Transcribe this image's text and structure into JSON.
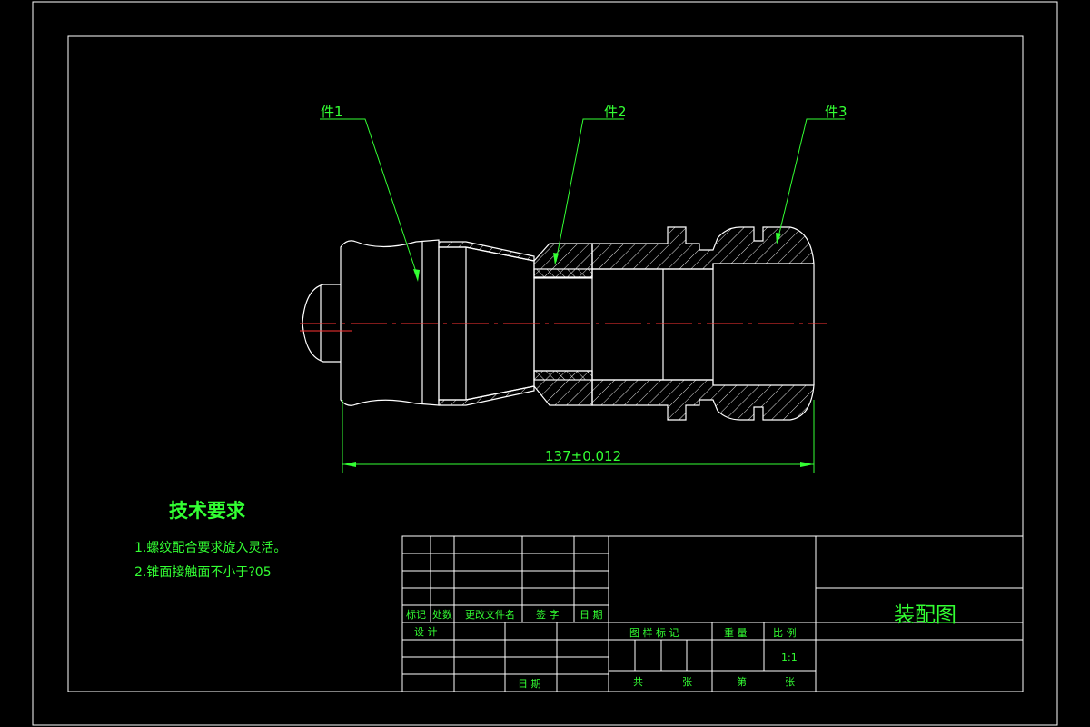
{
  "callouts": {
    "part1": "件1",
    "part2": "件2",
    "part3": "件3"
  },
  "dimension": {
    "overall_length": "137±0.012"
  },
  "technical_requirements": {
    "heading": "技术要求",
    "items": [
      "1.螺纹配合要求旋入灵活。",
      "2.锥面接触面不小于?05"
    ]
  },
  "title_block": {
    "drawing_title": "装配图",
    "revision_headers": [
      "标记",
      "处数",
      "更改文件名",
      "签 字",
      "日 期"
    ],
    "design_label": "设 计",
    "date_label": "日 期",
    "stage_mark_label": "图 样 标 记",
    "weight_label": "重 量",
    "scale_label": "比 例",
    "scale_value": "1:1",
    "total_sheets_label": "共",
    "sheet_unit_label": "张",
    "sheet_no_label": "第",
    "sheet_unit_label_2": "张"
  },
  "colors": {
    "background": "#000000",
    "outline": "#ffffff",
    "annotation": "#33ff33",
    "centerline": "#ff3333"
  }
}
